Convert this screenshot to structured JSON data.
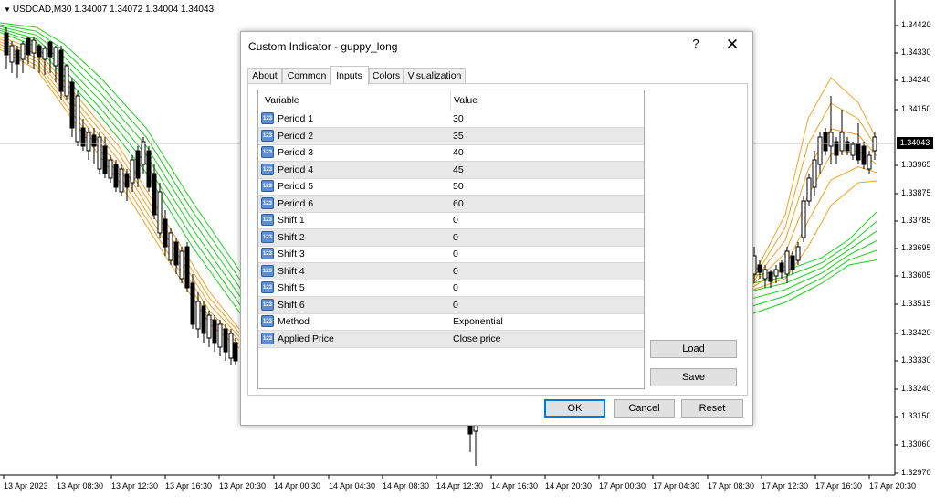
{
  "chart": {
    "title": "USDCAD,M30  1.34007 1.34072 1.34004 1.34043",
    "current_price": "1.34043",
    "y_ticks": [
      "1.34420",
      "1.34330",
      "1.34240",
      "1.34150",
      "1.33965",
      "1.33875",
      "1.33785",
      "1.33695",
      "1.33605",
      "1.33515",
      "1.33420",
      "1.33330",
      "1.33240",
      "1.33150",
      "1.33060",
      "1.32970"
    ],
    "x_ticks": [
      "13 Apr 2023",
      "13 Apr 08:30",
      "13 Apr 12:30",
      "13 Apr 16:30",
      "13 Apr 20:30",
      "14 Apr 00:30",
      "14 Apr 04:30",
      "14 Apr 08:30",
      "14 Apr 12:30",
      "14 Apr 16:30",
      "14 Apr 20:30",
      "17 Apr 00:30",
      "17 Apr 04:30",
      "17 Apr 08:30",
      "17 Apr 12:30",
      "17 Apr 16:30",
      "17 Apr 20:30"
    ],
    "colors": {
      "short_ema": "#f7a020",
      "long_ema": "#19d419",
      "candle": "#000000"
    }
  },
  "dialog": {
    "title": "Custom Indicator - guppy_long",
    "help_label": "?",
    "close_label": "✕",
    "tabs": [
      "About",
      "Common",
      "Inputs",
      "Colors",
      "Visualization"
    ],
    "active_tab": "Inputs",
    "columns": [
      "Variable",
      "Value"
    ],
    "rows": [
      {
        "icon": "123",
        "name": "Period 1",
        "value": "30"
      },
      {
        "icon": "123",
        "name": "Period 2",
        "value": "35"
      },
      {
        "icon": "123",
        "name": "Period 3",
        "value": "40"
      },
      {
        "icon": "123",
        "name": "Period 4",
        "value": "45"
      },
      {
        "icon": "123",
        "name": "Period 5",
        "value": "50"
      },
      {
        "icon": "123",
        "name": "Period 6",
        "value": "60"
      },
      {
        "icon": "123",
        "name": "Shift 1",
        "value": "0"
      },
      {
        "icon": "123",
        "name": "Shift 2",
        "value": "0"
      },
      {
        "icon": "123",
        "name": "Shift 3",
        "value": "0"
      },
      {
        "icon": "123",
        "name": "Shift 4",
        "value": "0"
      },
      {
        "icon": "123",
        "name": "Shift 5",
        "value": "0"
      },
      {
        "icon": "123",
        "name": "Shift 6",
        "value": "0"
      },
      {
        "icon": "123",
        "name": "Method",
        "value": "Exponential"
      },
      {
        "icon": "123",
        "name": "Applied Price",
        "value": "Close price"
      }
    ],
    "load_label": "Load",
    "save_label": "Save",
    "ok_label": "OK",
    "cancel_label": "Cancel",
    "reset_label": "Reset"
  }
}
